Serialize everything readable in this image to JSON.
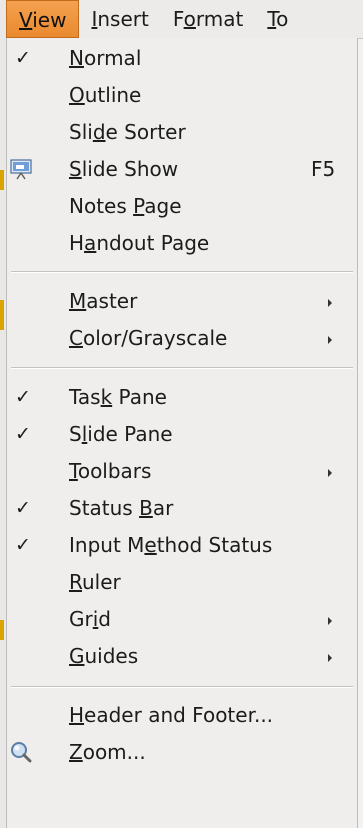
{
  "menubar": {
    "items": [
      {
        "pre": "",
        "key": "V",
        "post": "iew",
        "active": true
      },
      {
        "pre": "",
        "key": "I",
        "post": "nsert",
        "active": false
      },
      {
        "pre": "F",
        "key": "o",
        "post": "rmat",
        "active": false
      },
      {
        "pre": "",
        "key": "T",
        "post": "o",
        "active": false
      }
    ]
  },
  "menu": {
    "items": [
      {
        "pre": "",
        "key": "N",
        "post": "ormal",
        "checked": true
      },
      {
        "pre": "",
        "key": "O",
        "post": "utline"
      },
      {
        "pre": "Sli",
        "key": "d",
        "post": "e Sorter"
      },
      {
        "pre": "",
        "key": "S",
        "post": "lide Show",
        "shortcut": "F5",
        "icon": "slideshow-icon"
      },
      {
        "pre": "Notes ",
        "key": "P",
        "post": "age"
      },
      {
        "pre": "H",
        "key": "a",
        "post": "ndout Page"
      },
      {
        "pre": "",
        "key": "M",
        "post": "aster",
        "submenu": true
      },
      {
        "pre": "",
        "key": "C",
        "post": "olor/Grayscale",
        "submenu": true
      },
      {
        "pre": "Tas",
        "key": "k",
        "post": " Pane",
        "checked": true
      },
      {
        "pre": "S",
        "key": "l",
        "post": "ide Pane",
        "checked": true
      },
      {
        "pre": "",
        "key": "T",
        "post": "oolbars",
        "submenu": true
      },
      {
        "pre": "Status ",
        "key": "B",
        "post": "ar",
        "checked": true
      },
      {
        "pre": "Input M",
        "key": "e",
        "post": "thod Status",
        "checked": true
      },
      {
        "pre": "",
        "key": "R",
        "post": "uler"
      },
      {
        "pre": "Gr",
        "key": "i",
        "post": "d",
        "submenu": true
      },
      {
        "pre": "",
        "key": "G",
        "post": "uides",
        "submenu": true
      },
      {
        "pre": "",
        "key": "H",
        "post": "eader and Footer..."
      },
      {
        "pre": "",
        "key": "Z",
        "post": "oom...",
        "icon": "zoom-icon"
      }
    ],
    "checkmark": "✓"
  },
  "colors": {
    "active_menu": "#ea8a2f",
    "menu_bg": "#efeeed",
    "text": "#1c1c1c"
  }
}
